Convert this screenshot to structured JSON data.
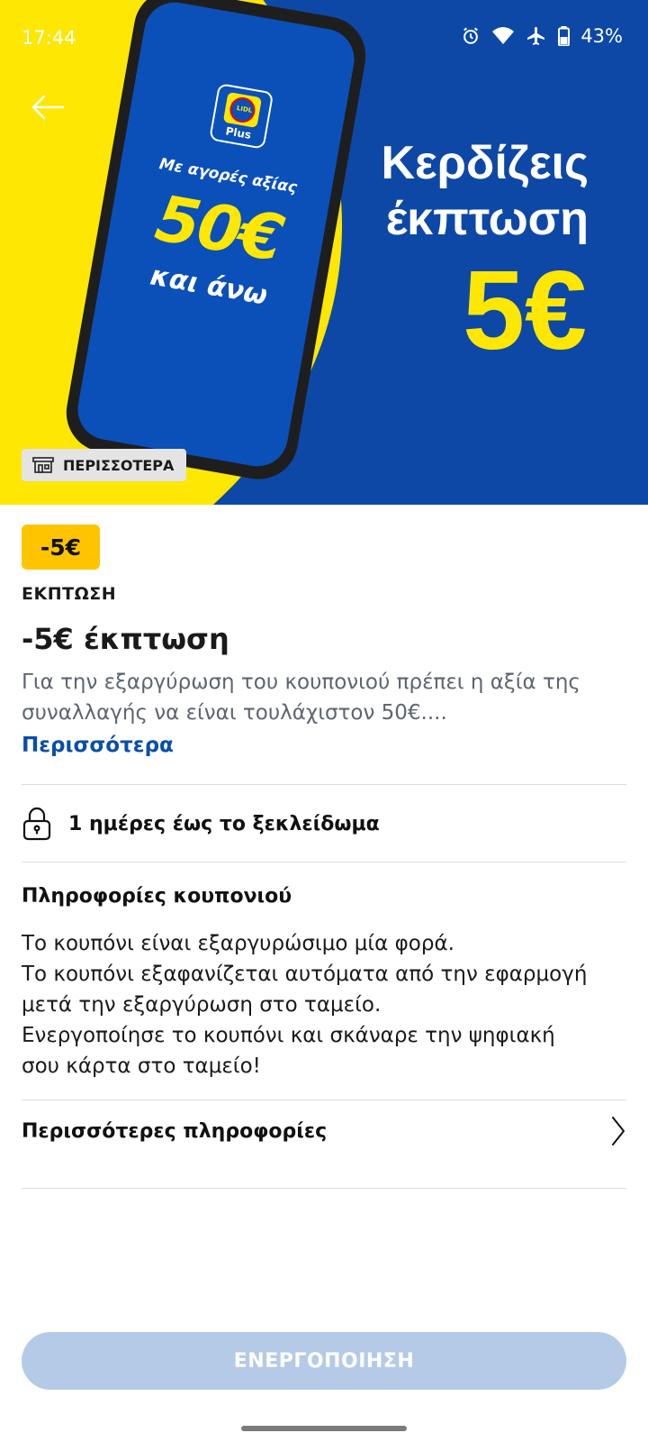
{
  "status_bar": {
    "time": "17:44",
    "battery": "43%",
    "icons": [
      "alarm-icon",
      "wifi-icon",
      "airplane-icon",
      "battery-icon"
    ]
  },
  "hero": {
    "phone_brand": "LIDL",
    "phone_brand_sub": "Plus",
    "phone_line1": "Με αγορές αξίας",
    "phone_line2": "50€",
    "phone_line3": "και άνω",
    "headline_line1": "Κερδίζεις",
    "headline_line2": "έκπτωση",
    "headline_amount": "5€",
    "more_chip_label": "ΠΕΡΙΣΣΟΤΕΡΑ",
    "colors": {
      "blue": "#0d48a6",
      "yellow": "#fde703"
    }
  },
  "coupon": {
    "badge": "-5€",
    "category": "ΕΚΠΤΩΣΗ",
    "title": "-5€ έκπτωση",
    "description_line1": "Για την εξαργύρωση του κουπονιού πρέπει η αξία της",
    "description_line2": "συναλλαγής να είναι τουλάχιστον 50€....",
    "more_link": "Περισσότερα",
    "lock_text": "1 ημέρες έως το ξεκλείδωμα"
  },
  "info": {
    "title": "Πληροφορίες κουπονιού",
    "lines": [
      "Το κουπόνι είναι εξαργυρώσιμο μία φορά.",
      "Το κουπόνι εξαφανίζεται αυτόματα από την εφαρμογή",
      "μετά την εξαργύρωση στο ταμείο.",
      "Ενεργοποίησε το κουπόνι και σκάναρε την ψηφιακή",
      "σου κάρτα στο ταμείο!"
    ],
    "more_info_label": "Περισσότερες πληροφορίες"
  },
  "actions": {
    "activate_label": "ΕΝΕΡΓΟΠΟΙΗΣΗ",
    "activate_color": "#b4cae6"
  }
}
